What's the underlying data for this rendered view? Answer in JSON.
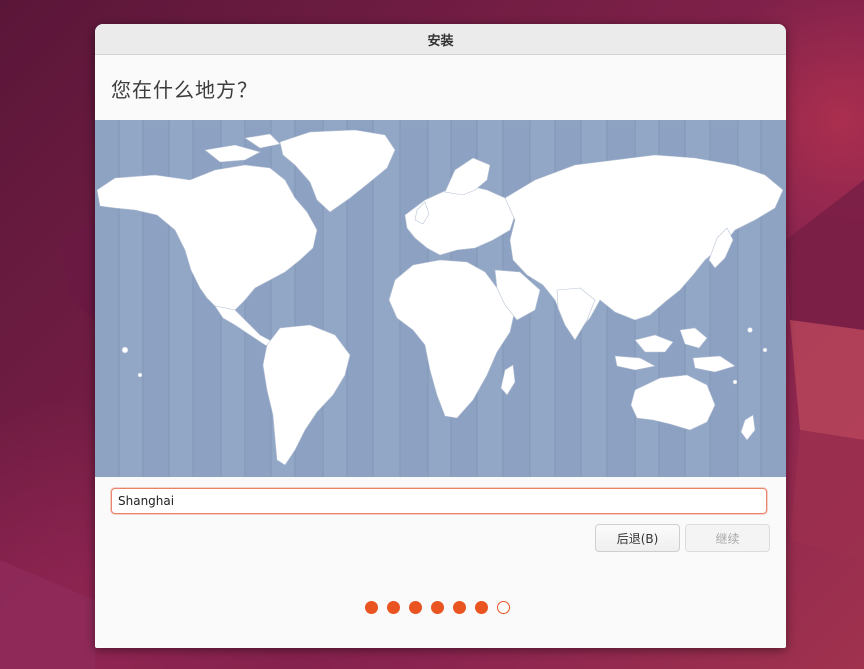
{
  "window": {
    "title": "安装"
  },
  "page": {
    "heading": "您在什么地方？"
  },
  "location": {
    "value": "Shanghai"
  },
  "buttons": {
    "back_label": "后退(B)",
    "continue_label": "继续"
  },
  "progress": {
    "total_steps": 7,
    "completed_steps": 6
  },
  "colors": {
    "accent": "#e95420",
    "map_water": "#92a6c6",
    "map_land": "#ffffff"
  }
}
